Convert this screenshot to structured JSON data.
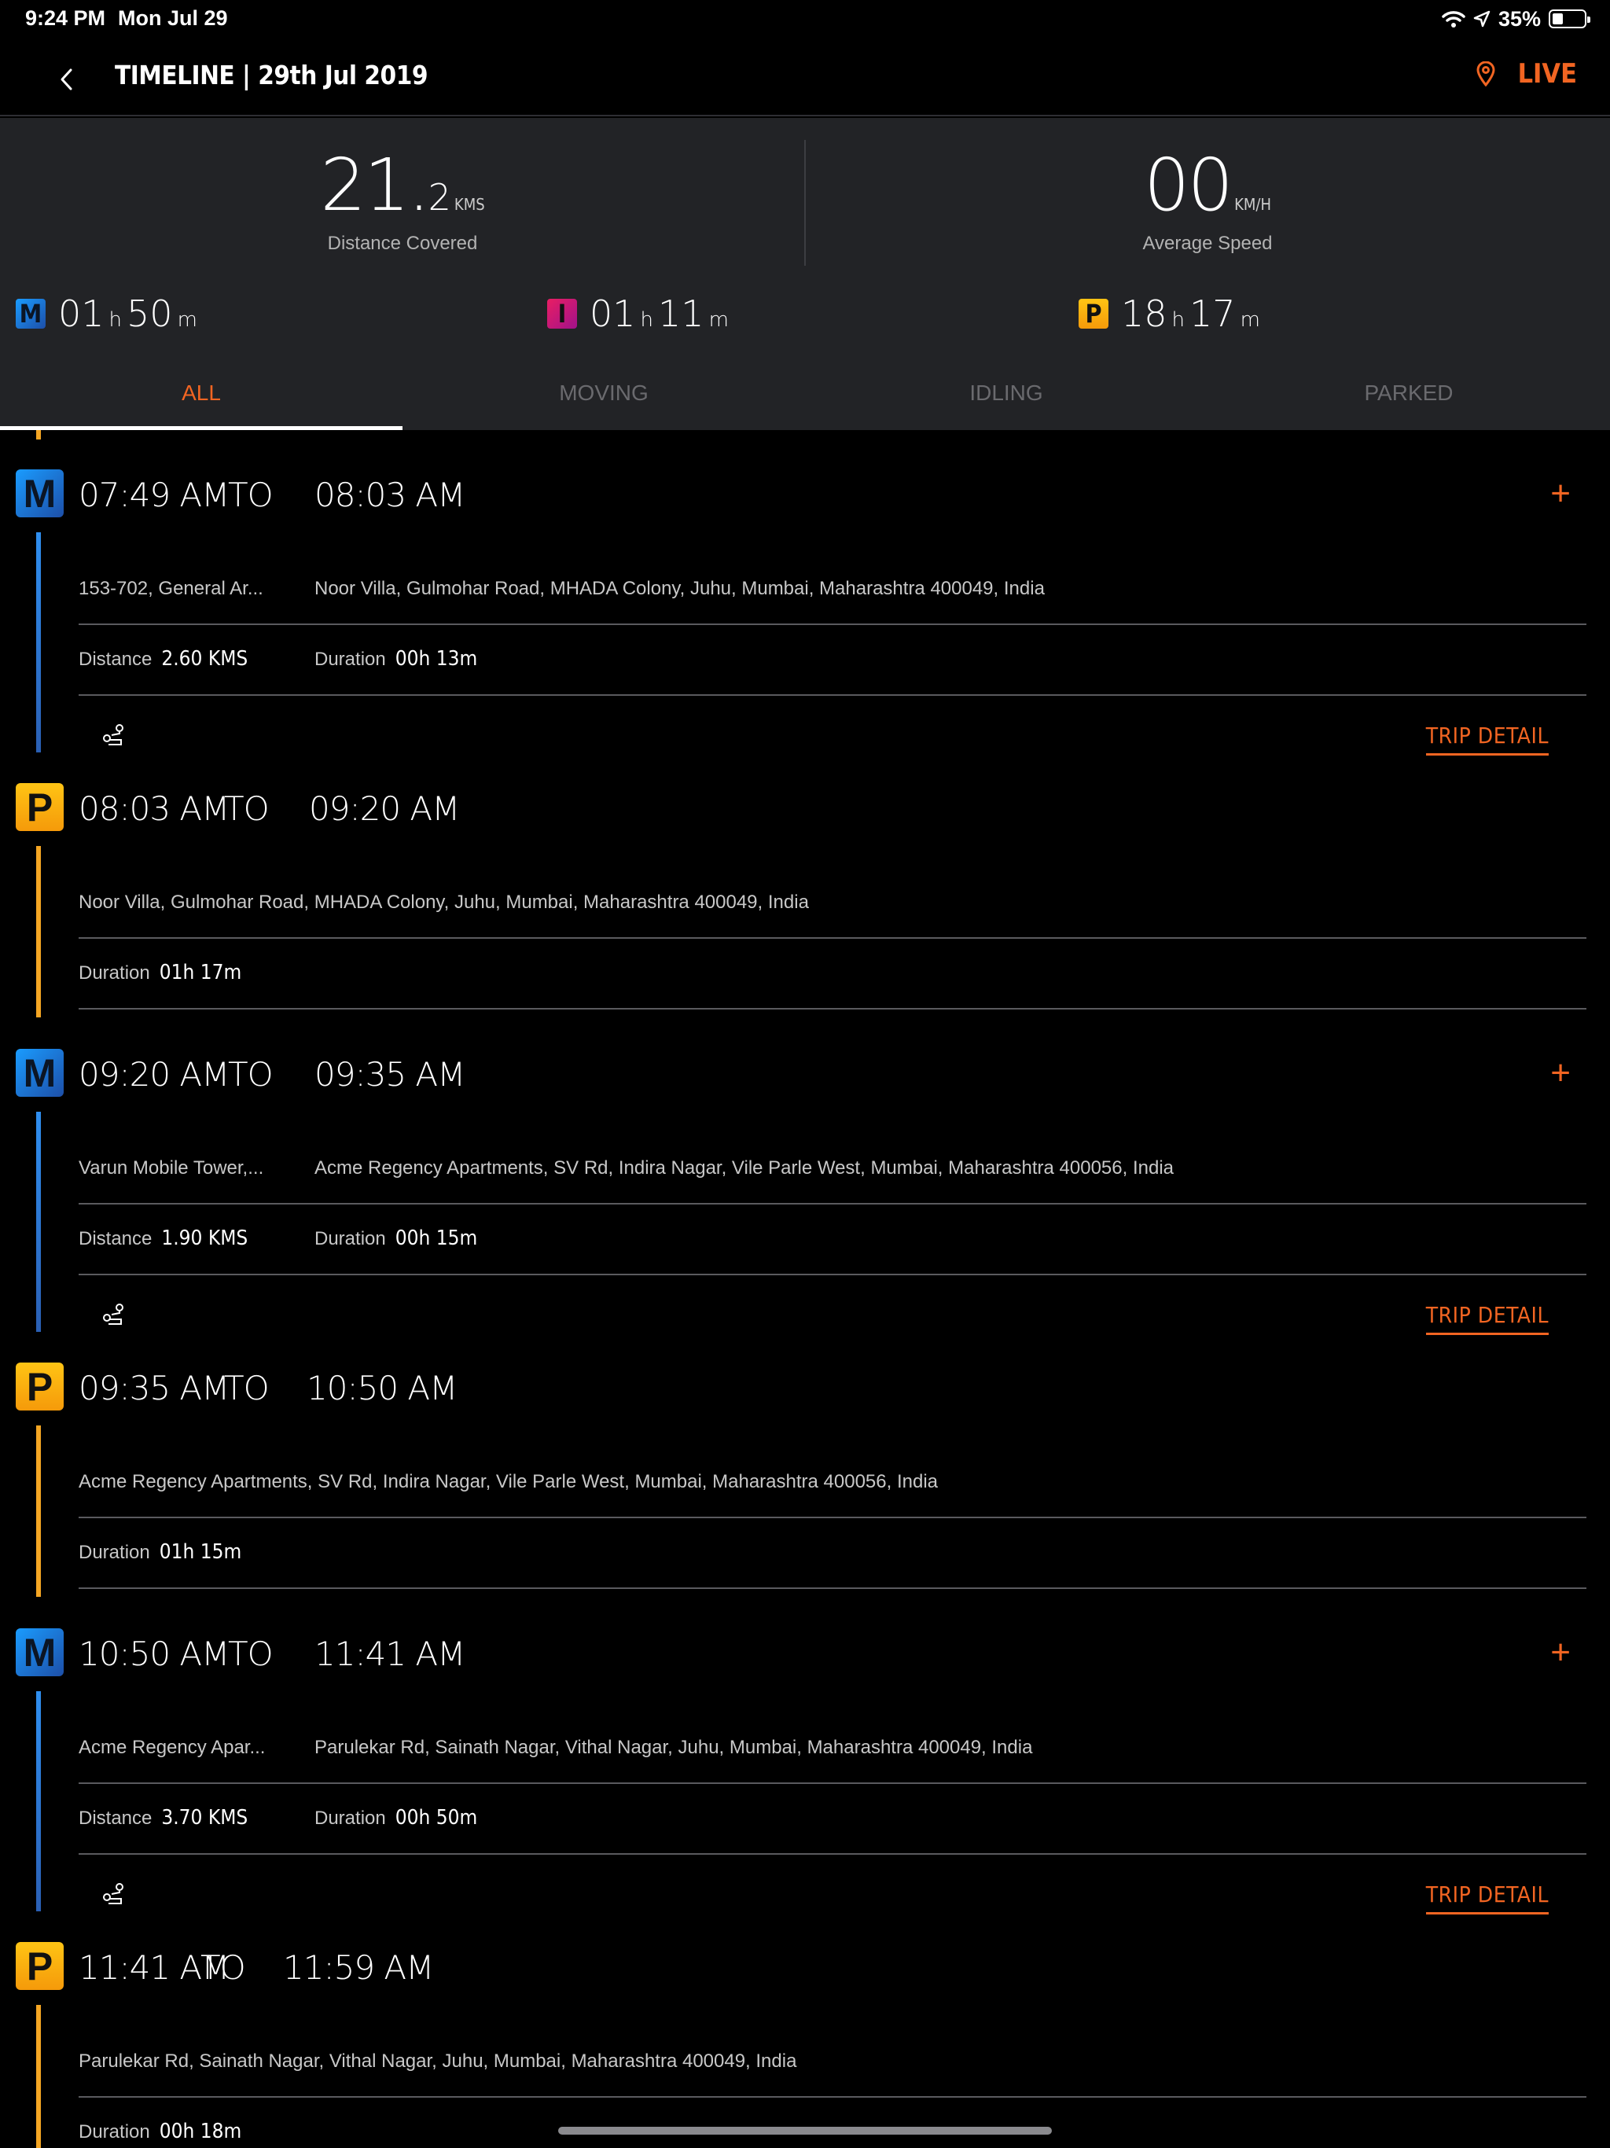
{
  "status_bar": {
    "time": "9:24 PM",
    "date": "Mon Jul 29",
    "battery": "35%"
  },
  "nav": {
    "title": "TIMELINE | 29th Jul 2019",
    "live_label": "LIVE"
  },
  "summary": {
    "distance_int": "21.",
    "distance_dec": "2",
    "distance_unit": "KMS",
    "distance_caption": "Distance Covered",
    "speed": "00",
    "speed_unit": "KM/H",
    "speed_caption": "Average Speed",
    "moving": {
      "badge": "M",
      "h": "01",
      "m": "50"
    },
    "idling": {
      "badge": "I",
      "h": "01",
      "m": "11"
    },
    "parked": {
      "badge": "P",
      "h": "18",
      "m": "17"
    },
    "h_suffix": "h",
    "m_suffix": "m"
  },
  "tabs": [
    "ALL",
    "MOVING",
    "IDLING",
    "PARKED"
  ],
  "labels": {
    "to": "TO",
    "distance": "Distance",
    "duration": "Duration",
    "trip_detail": "TRIP DETAIL",
    "plus": "+"
  },
  "entries": [
    {
      "type": "M",
      "from_time": "07:49 AM",
      "to_time": "08:03 AM",
      "from_addr": "153-702, General Ar...",
      "to_addr": "Noor Villa, Gulmohar Road, MHADA Colony, Juhu, Mumbai, Maharashtra 400049, India",
      "distance": "2.60 KMS",
      "duration": "00h 13m"
    },
    {
      "type": "P",
      "from_time": "08:03 AM",
      "to_time": "09:20 AM",
      "address": "Noor Villa, Gulmohar Road, MHADA Colony, Juhu, Mumbai, Maharashtra 400049, India",
      "duration": "01h 17m"
    },
    {
      "type": "M",
      "from_time": "09:20 AM",
      "to_time": "09:35 AM",
      "from_addr": "Varun Mobile Tower,...",
      "to_addr": "Acme Regency Apartments, SV Rd, Indira Nagar, Vile Parle West, Mumbai, Maharashtra 400056, India",
      "distance": "1.90 KMS",
      "duration": "00h 15m"
    },
    {
      "type": "P",
      "from_time": "09:35 AM",
      "to_time": "10:50 AM",
      "address": "Acme Regency Apartments, SV Rd, Indira Nagar, Vile Parle West, Mumbai, Maharashtra 400056, India",
      "duration": "01h 15m"
    },
    {
      "type": "M",
      "from_time": "10:50 AM",
      "to_time": "11:41 AM",
      "from_addr": "Acme Regency Apar...",
      "to_addr": "Parulekar Rd, Sainath Nagar, Vithal Nagar, Juhu, Mumbai, Maharashtra 400049, India",
      "distance": "3.70 KMS",
      "duration": "00h 50m"
    },
    {
      "type": "P",
      "from_time": "11:41 AM",
      "to_time": "11:59 AM",
      "address": "Parulekar Rd, Sainath Nagar, Vithal Nagar, Juhu, Mumbai, Maharashtra 400049, India",
      "duration": "00h 18m"
    }
  ],
  "colors": {
    "accent": "#f26522",
    "moving": "#1a9cff",
    "parked": "#f5a623",
    "idling": "#e91e63",
    "panel": "#222326"
  }
}
